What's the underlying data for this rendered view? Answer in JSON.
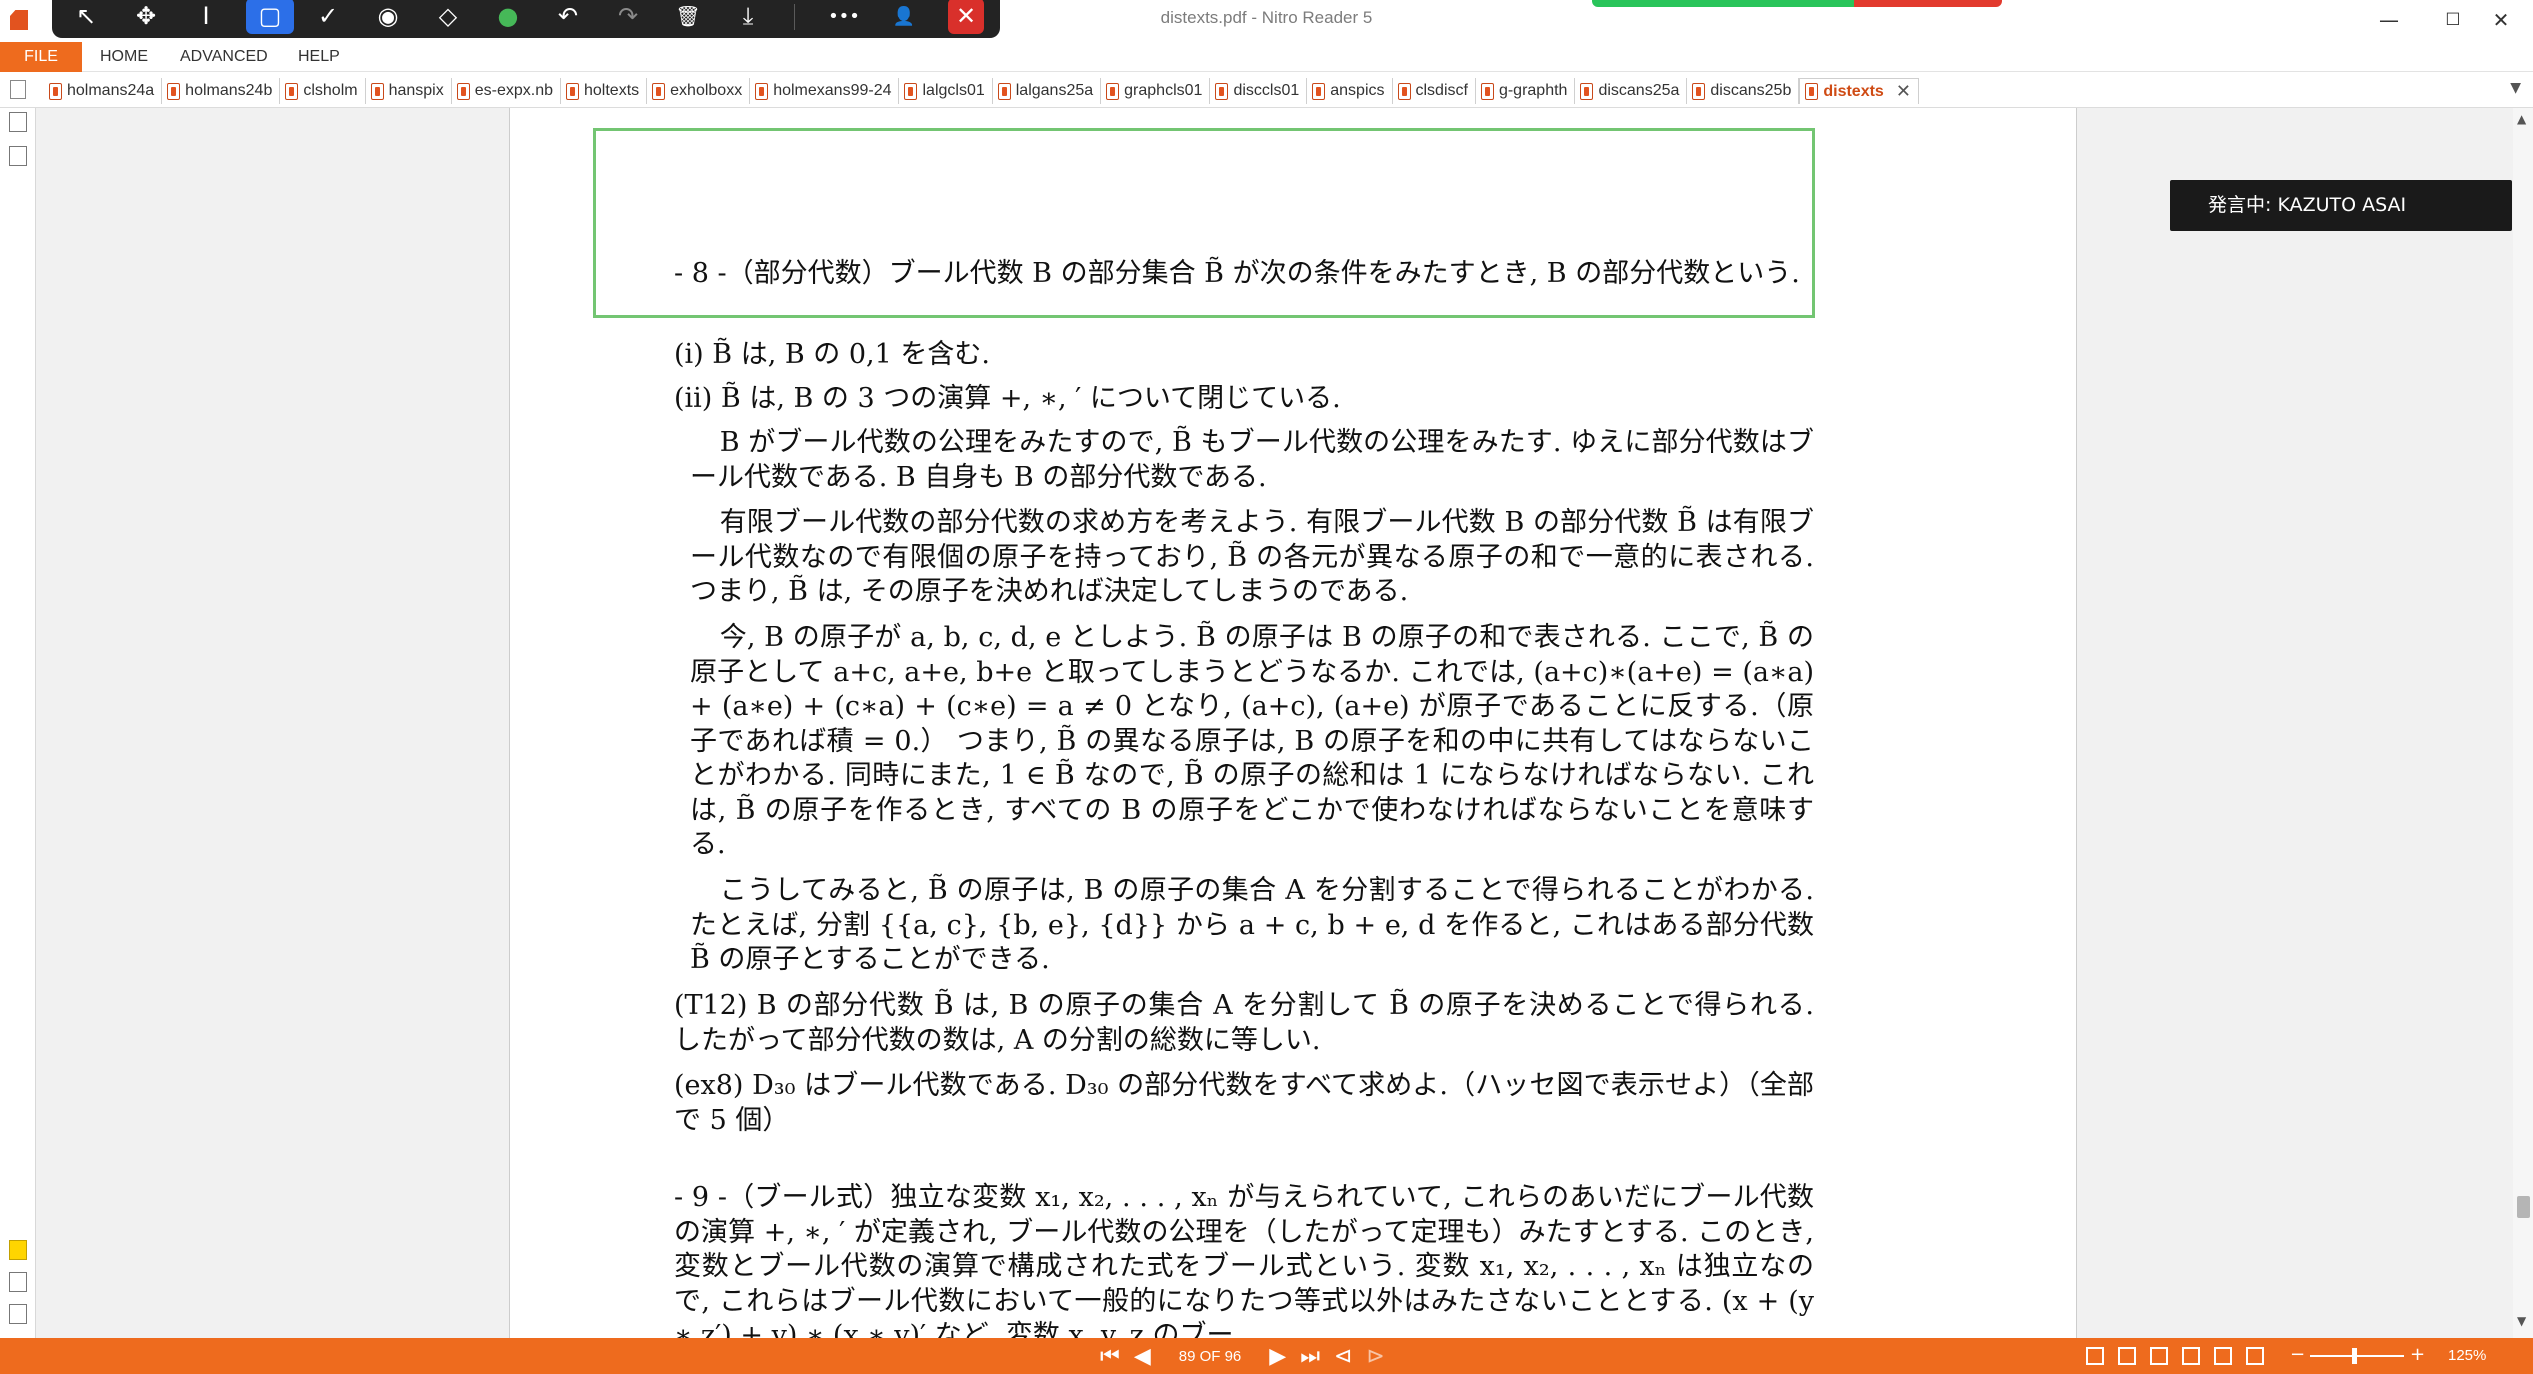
{
  "window": {
    "title": "distexts.pdf - Nitro Reader 5",
    "minimize": "—",
    "maximize": "☐",
    "close": "✕"
  },
  "floating_toolbar": {
    "tools": [
      {
        "name": "select-arrow-icon",
        "glyph": "↖"
      },
      {
        "name": "move-icon",
        "glyph": "✥"
      },
      {
        "name": "text-cursor-icon",
        "glyph": "I"
      },
      {
        "name": "rectangle-icon",
        "glyph": "▢"
      },
      {
        "name": "check-icon",
        "glyph": "✓"
      },
      {
        "name": "stamp-icon",
        "glyph": "◉"
      },
      {
        "name": "eraser-icon",
        "glyph": "◇"
      },
      {
        "name": "color-icon",
        "glyph": "●"
      },
      {
        "name": "undo-icon",
        "glyph": "↶"
      },
      {
        "name": "redo-icon",
        "glyph": "↷"
      },
      {
        "name": "delete-icon",
        "glyph": "🗑"
      },
      {
        "name": "save-icon",
        "glyph": "⤓"
      },
      {
        "name": "more-icon",
        "glyph": "•••"
      },
      {
        "name": "user-icon",
        "glyph": "👤"
      },
      {
        "name": "close-icon",
        "glyph": "✕"
      }
    ]
  },
  "menu": {
    "file": "FILE",
    "home": "HOME",
    "advanced": "ADVANCED",
    "help": "HELP"
  },
  "tabs": [
    "holmans24a",
    "holmans24b",
    "clsholm",
    "hanspix",
    "es-expx.nb",
    "holtexts",
    "exholboxx",
    "holmexans99-24",
    "lalgcls01",
    "lalgans25a",
    "graphcls01",
    "disccls01",
    "anspics",
    "clsdiscf",
    "g-graphth",
    "discans25a",
    "discans25b",
    "distexts"
  ],
  "speaker_banner": "発言中: KAZUTO ASAI",
  "document": {
    "p1": "- 8 -（部分代数）ブール代数 B の部分集合 B̃ が次の条件をみたすとき, B の部分代数という.",
    "p2": "(i)  B̃ は, B の 0,1 を含む.",
    "p3": "(ii)  B̃ は, B の 3 つの演算 +, ∗, ′ について閉じている.",
    "p4": "B がブール代数の公理をみたすので, B̃ もブール代数の公理をみたす. ゆえに部分代数はブール代数である. B 自身も B の部分代数である.",
    "p5": "有限ブール代数の部分代数の求め方を考えよう. 有限ブール代数 B の部分代数 B̃ は有限ブール代数なので有限個の原子を持っており, B̃ の各元が異なる原子の和で一意的に表される. つまり, B̃ は, その原子を決めれば決定してしまうのである.",
    "p6": "今, B の原子が a, b, c, d, e としよう. B̃ の原子は B の原子の和で表される. ここで, B̃ の原子として a+c, a+e, b+e と取ってしまうとどうなるか. これでは, (a+c)∗(a+e) = (a∗a) + (a∗e) + (c∗a) + (c∗e) = a ≠ 0 となり, (a+c), (a+e) が原子であることに反する.（原子であれば積 = 0.） つまり, B̃ の異なる原子は, B の原子を和の中に共有してはならないことがわかる. 同時にまた, 1 ∈ B̃ なので, B̃ の原子の総和は 1 にならなければならない. これは, B̃ の原子を作るとき, すべての B の原子をどこかで使わなければならないことを意味する.",
    "p7": "こうしてみると, B̃ の原子は, B の原子の集合 A を分割することで得られることがわかる. たとえば, 分割 {{a, c}, {b, e}, {d}} から a + c, b + e, d を作ると, これはある部分代数 B̃ の原子とすることができる.",
    "p8": "(T12)  B の部分代数 B̃ は, B の原子の集合 A を分割して B̃ の原子を決めることで得られる. したがって部分代数の数は, A の分割の総数に等しい.",
    "p9": "(ex8)  D₃₀ はブール代数である. D₃₀ の部分代数をすべて求めよ.（ハッセ図で表示せよ）（全部で 5 個）",
    "p10": "- 9 -（ブール式）独立な変数 x₁, x₂, . . . , xₙ が与えられていて, これらのあいだにブール代数の演算 +, ∗, ′ が定義され, ブール代数の公理を（したがって定理も）みたすとする. このとき, 変数とブール代数の演算で構成された式をブール式という. 変数 x₁, x₂, . . . , xₙ は独立なので, これらはブール代数において一般的になりたつ等式以外はみたさないこととする. (x + (y ∗ z′) + y) ∗ (x ∗ y)′ など, 変数 x, y, z のブー"
  },
  "status": {
    "page_indicator": "89 OF 96",
    "zoom_minus": "−",
    "zoom_plus": "+",
    "zoom_level": "125%"
  },
  "colors": {
    "accent": "#ee6b1e",
    "highlight_box": "#73c572",
    "active_tool": "#2c6fe8"
  }
}
